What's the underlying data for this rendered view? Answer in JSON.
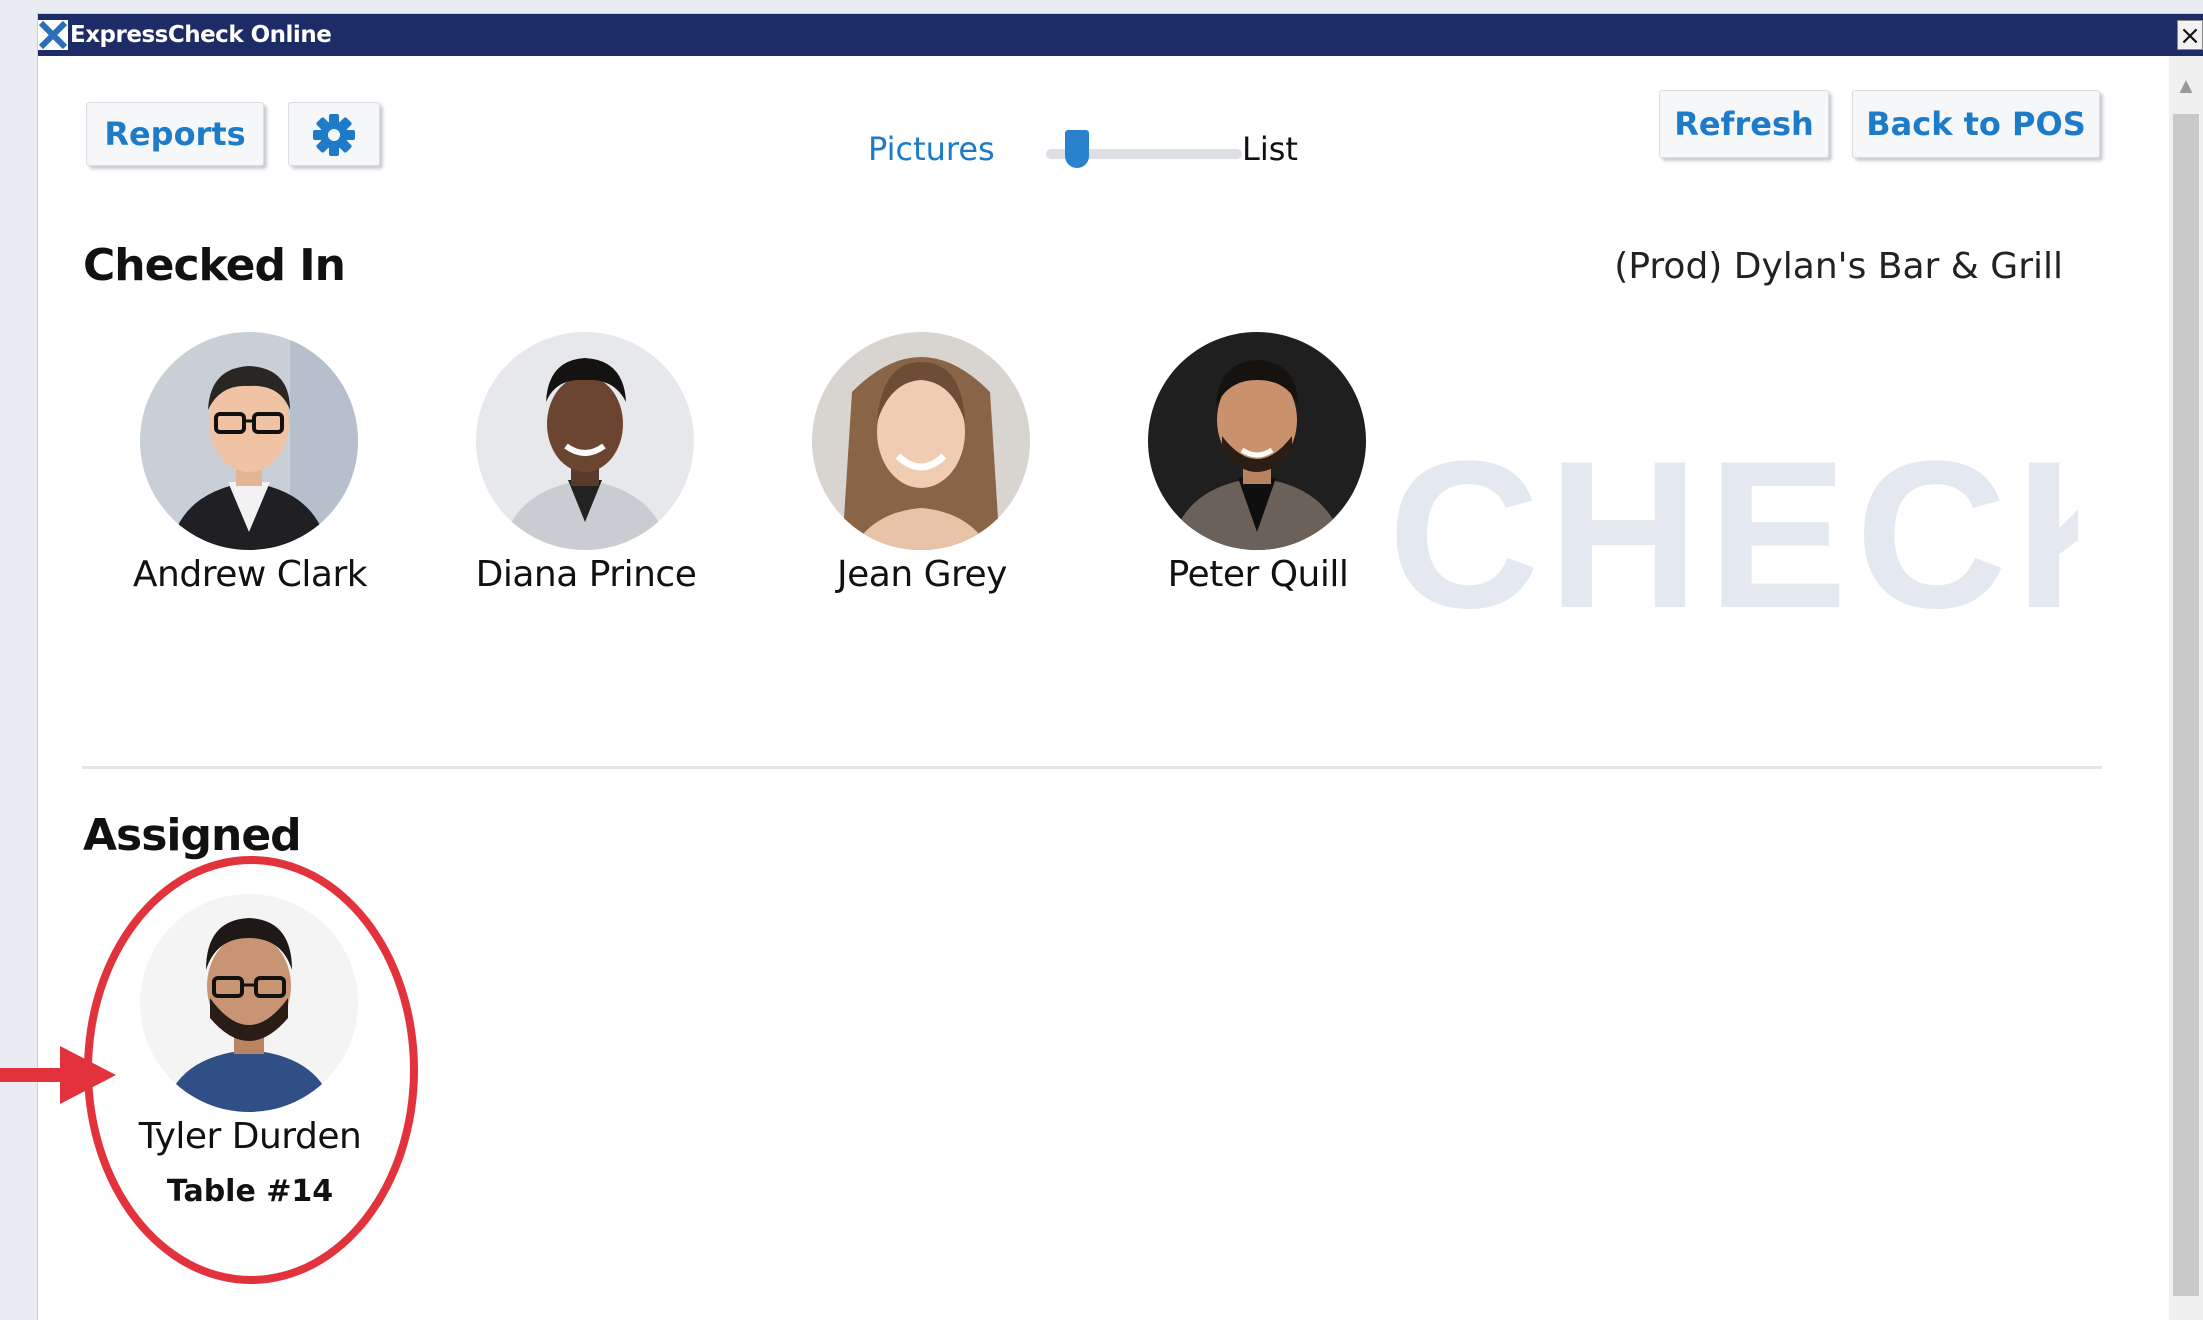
{
  "window": {
    "title": "ExpressCheck Online",
    "close_label": "✕"
  },
  "toolbar": {
    "reports_label": "Reports",
    "settings_icon": "gear-icon",
    "view_toggle": {
      "left_label": "Pictures",
      "right_label": "List",
      "selected": "Pictures"
    },
    "refresh_label": "Refresh",
    "back_label": "Back to POS"
  },
  "location": "(Prod) Dylan's Bar & Grill",
  "watermark": "CHECK",
  "checked_in": {
    "title": "Checked In",
    "people": [
      {
        "name": "Andrew Clark"
      },
      {
        "name": "Diana Prince"
      },
      {
        "name": "Jean Grey"
      },
      {
        "name": "Peter Quill"
      }
    ]
  },
  "assigned": {
    "title": "Assigned",
    "people": [
      {
        "name": "Tyler Durden",
        "table": "Table #14"
      }
    ]
  },
  "colors": {
    "titlebar": "#1d2c66",
    "accent": "#1d7bc8",
    "highlight": "#e2323c"
  }
}
